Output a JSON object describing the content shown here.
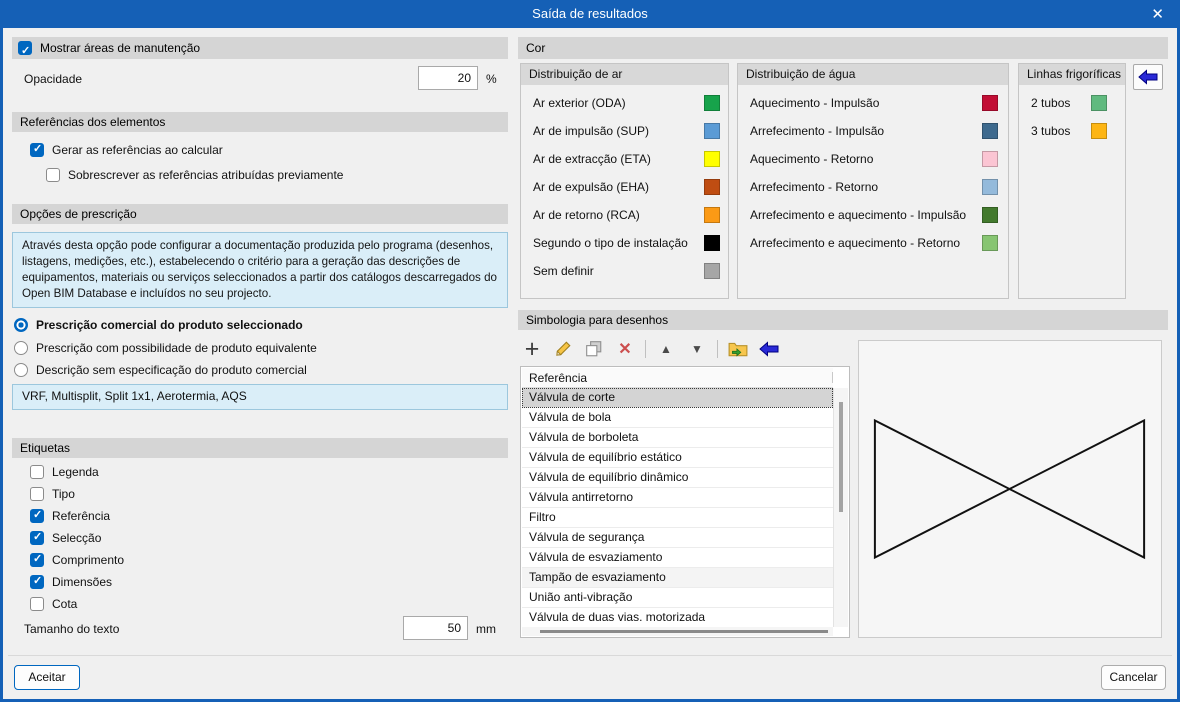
{
  "window": {
    "title": "Saída de resultados",
    "close_icon": "✕"
  },
  "left": {
    "maintenance": {
      "label": "Mostrar áreas de manutenção",
      "checked": true
    },
    "opacity": {
      "label": "Opacidade",
      "value": "20",
      "unit": "%"
    },
    "references": {
      "title": "Referências dos elementos",
      "generate": {
        "label": "Gerar as referências ao calcular",
        "checked": true
      },
      "overwrite": {
        "label": "Sobrescrever as referências atribuídas previamente",
        "checked": false
      }
    },
    "prescription": {
      "title": "Opções de prescrição",
      "info": "Através desta opção pode configurar a documentação produzida pelo programa (desenhos, listagens, medições, etc.), estabelecendo o critério para a geração das descrições de equipamentos, materiais ou serviços seleccionados a partir dos catálogos descarregados do Open BIM Database e incluídos no seu projecto.",
      "options": [
        {
          "label": "Prescrição comercial do produto seleccionado",
          "selected": true
        },
        {
          "label": "Prescrição com possibilidade de produto equivalente",
          "selected": false
        },
        {
          "label": "Descrição sem especificação do produto comercial",
          "selected": false
        }
      ],
      "value_box": "VRF, Multisplit, Split 1x1, Aerotermia, AQS"
    },
    "labels": {
      "title": "Etiquetas",
      "items": [
        {
          "label": "Legenda",
          "checked": false
        },
        {
          "label": "Tipo",
          "checked": false
        },
        {
          "label": "Referência",
          "checked": true
        },
        {
          "label": "Selecção",
          "checked": true
        },
        {
          "label": "Comprimento",
          "checked": true
        },
        {
          "label": "Dimensões",
          "checked": true
        },
        {
          "label": "Cota",
          "checked": false
        }
      ],
      "text_size": {
        "label": "Tamanho do texto",
        "value": "50",
        "unit": "mm"
      }
    }
  },
  "color": {
    "title": "Cor",
    "air": {
      "title": "Distribuição de ar",
      "items": [
        {
          "label": "Ar exterior (ODA)",
          "color": "#17a34b"
        },
        {
          "label": "Ar de impulsão (SUP)",
          "color": "#5b9bd5"
        },
        {
          "label": "Ar de extracção (ETA)",
          "color": "#ffff00"
        },
        {
          "label": "Ar de expulsão (EHA)",
          "color": "#bf4d12"
        },
        {
          "label": "Ar de retorno (RCA)",
          "color": "#fb9a15"
        },
        {
          "label": "Segundo o tipo de instalação",
          "color": "#000000"
        },
        {
          "label": "Sem definir",
          "color": "#a6a6a6"
        }
      ]
    },
    "water": {
      "title": "Distribuição de água",
      "items": [
        {
          "label": "Aquecimento - Impulsão",
          "color": "#c20e35"
        },
        {
          "label": "Arrefecimento - Impulsão",
          "color": "#3e6a8e"
        },
        {
          "label": "Aquecimento - Retorno",
          "color": "#fbc5d3"
        },
        {
          "label": "Arrefecimento - Retorno",
          "color": "#94badb"
        },
        {
          "label": "Arrefecimento e aquecimento - Impulsão",
          "color": "#437a2e"
        },
        {
          "label": "Arrefecimento e aquecimento - Retorno",
          "color": "#87c572"
        }
      ]
    },
    "refrigerant": {
      "title": "Linhas frigoríficas",
      "items": [
        {
          "label": "2 tubos",
          "color": "#60ba7f"
        },
        {
          "label": "3 tubos",
          "color": "#fdb513"
        }
      ]
    }
  },
  "symbology": {
    "title": "Simbologia para desenhos",
    "toolbar_icons": [
      "add-icon",
      "edit-icon",
      "duplicate-icon",
      "delete-icon",
      "move-up-icon",
      "move-down-icon",
      "import-folder-icon",
      "restore-arrow-icon"
    ],
    "list": {
      "header": "Referência",
      "rows": [
        "Válvula de corte",
        "Válvula de bola",
        "Válvula de borboleta",
        "Válvula de equilíbrio estático",
        "Válvula de equilíbrio dinâmico",
        "Válvula antirretorno",
        "Filtro",
        "Válvula de segurança",
        "Válvula de esvaziamento",
        "Tampão de esvaziamento",
        "União anti-vibração",
        "Válvula de duas vias. motorizada"
      ],
      "selected": "Válvula de corte"
    }
  },
  "footer": {
    "accept": "Aceitar",
    "cancel": "Cancelar"
  }
}
